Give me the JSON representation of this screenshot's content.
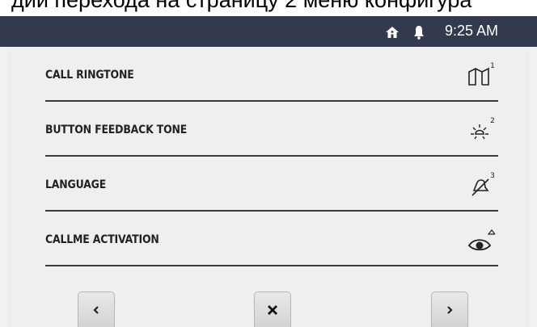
{
  "caption": {
    "text": "дии перехода на страницу 2 меню конфигура"
  },
  "status_bar": {
    "time": "9:25 AM",
    "icons": [
      "home-icon",
      "bell-icon"
    ]
  },
  "menu": {
    "items": [
      {
        "label": "CALL RINGTONE",
        "index": "1",
        "icon": "door-icon"
      },
      {
        "label": "BUTTON FEEDBACK TONE",
        "index": "2",
        "icon": "lamp-icon"
      },
      {
        "label": "LANGUAGE",
        "index": "3",
        "icon": "bell-muted-icon"
      },
      {
        "label": "CALLME ACTIVATION",
        "index": "",
        "icon": "eye-icon"
      }
    ]
  },
  "nav": {
    "prev": "previous-icon",
    "close": "close-icon",
    "next": "next-icon"
  },
  "colors": {
    "status_bar": "#343a4d",
    "panel": "#efefef",
    "divider": "#3b3b3b"
  }
}
